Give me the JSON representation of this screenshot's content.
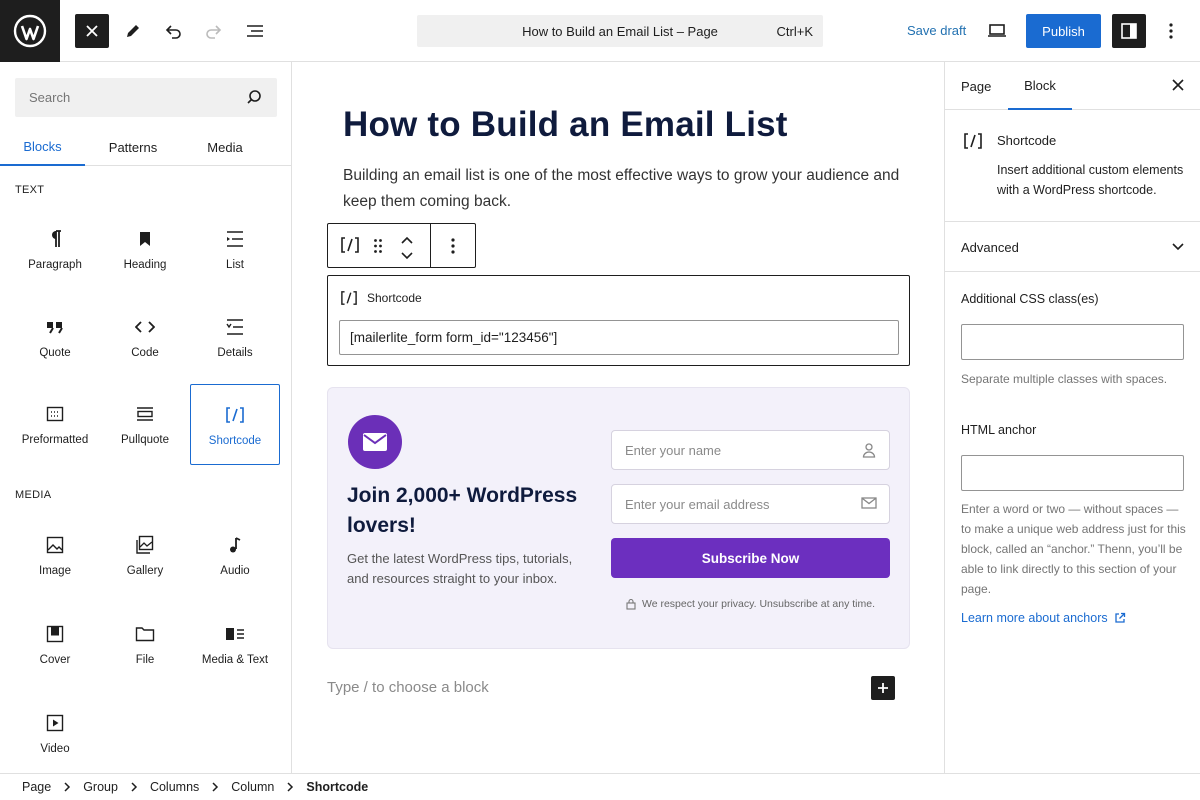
{
  "topbar": {
    "document_title": "How to Build an Email List – Page",
    "shortcut": "Ctrl+K",
    "save_draft": "Save draft",
    "publish": "Publish"
  },
  "inserter": {
    "search_placeholder": "Search",
    "tabs": [
      "Blocks",
      "Patterns",
      "Media"
    ],
    "active_tab": "Blocks",
    "sections": [
      {
        "label": "TEXT",
        "blocks": [
          {
            "label": "Paragraph",
            "icon": "paragraph-icon"
          },
          {
            "label": "Heading",
            "icon": "heading-icon"
          },
          {
            "label": "List",
            "icon": "list-icon"
          },
          {
            "label": "Quote",
            "icon": "quote-icon"
          },
          {
            "label": "Code",
            "icon": "code-icon"
          },
          {
            "label": "Details",
            "icon": "details-icon"
          },
          {
            "label": "Preformatted",
            "icon": "preformatted-icon"
          },
          {
            "label": "Pullquote",
            "icon": "pullquote-icon"
          },
          {
            "label": "Shortcode",
            "icon": "shortcode-icon",
            "selected": true
          }
        ]
      },
      {
        "label": "MEDIA",
        "blocks": [
          {
            "label": "Image",
            "icon": "image-icon"
          },
          {
            "label": "Gallery",
            "icon": "gallery-icon"
          },
          {
            "label": "Audio",
            "icon": "audio-icon"
          },
          {
            "label": "Cover",
            "icon": "cover-icon"
          },
          {
            "label": "File",
            "icon": "file-icon"
          },
          {
            "label": "Media & Text",
            "icon": "media-text-icon"
          },
          {
            "label": "Video",
            "icon": "video-icon"
          }
        ]
      }
    ]
  },
  "canvas": {
    "title": "How to Build an Email List",
    "paragraph": "Building an email list is one of the most effective ways to grow your audience and keep them coming back.",
    "shortcode_block": {
      "label": "Shortcode",
      "value": "[mailerlite_form form_id=\"123456\"]"
    },
    "form": {
      "title": "Join 2,000+ WordPress lovers!",
      "description": "Get the latest WordPress tips, tutorials, and resources straight to your inbox.",
      "name_placeholder": "Enter your name",
      "email_placeholder": "Enter your email address",
      "button": "Subscribe Now",
      "privacy": "We respect your privacy. Unsubscribe at any time.",
      "accent_color": "#6c2fbf"
    },
    "appender_placeholder": "Type / to choose a block"
  },
  "sidebar": {
    "tabs": [
      "Page",
      "Block"
    ],
    "active_tab": "Block",
    "block_card": {
      "name": "Shortcode",
      "description": "Insert additional custom elements with a WordPress shortcode."
    },
    "advanced_label": "Advanced",
    "css_label": "Additional CSS class(es)",
    "css_help": "Separate multiple classes with spaces.",
    "anchor_label": "HTML anchor",
    "anchor_help": "Enter a word or two — without spaces — to make a unique web address just for this block, called an “anchor.” Thenn, you’ll be able to link directly to this section of your page.",
    "anchor_link": "Learn more about anchors"
  },
  "breadcrumbs": [
    "Page",
    "Group",
    "Columns",
    "Column",
    "Shortcode"
  ],
  "colors": {
    "accent": "#1a6bd1",
    "dark": "#1e1e1e"
  }
}
